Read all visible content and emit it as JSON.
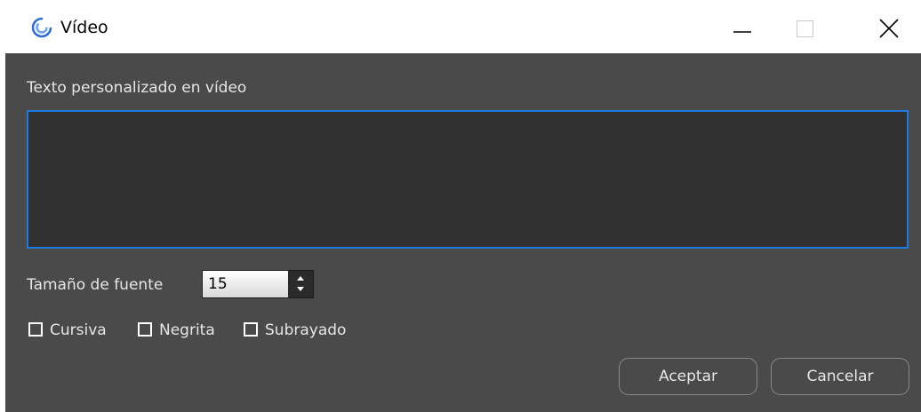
{
  "window": {
    "title": "Vídeo",
    "icons": {
      "app": "swirl-app-icon",
      "minimize": "minimize-icon",
      "maximize": "maximize-icon",
      "close": "close-icon"
    }
  },
  "form": {
    "custom_text_label": "Texto personalizado en vídeo",
    "custom_text_value": "",
    "font_size_label": "Tamaño de fuente",
    "font_size_value": "15",
    "options": [
      {
        "label": "Cursiva",
        "checked": false
      },
      {
        "label": "Negrita",
        "checked": false
      },
      {
        "label": "Subrayado",
        "checked": false
      }
    ]
  },
  "buttons": {
    "ok": "Aceptar",
    "cancel": "Cancelar"
  },
  "colors": {
    "client_bg": "#4a4a4a",
    "textarea_bg": "#313131",
    "focus_border": "#1f7ae0",
    "app_icon": "#2e6bd6"
  }
}
